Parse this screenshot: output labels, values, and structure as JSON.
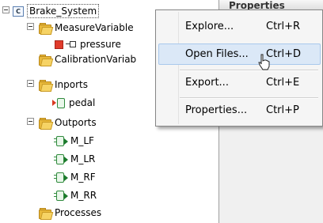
{
  "tree": {
    "root": {
      "badge": "C",
      "label": "Brake_System"
    },
    "measure": {
      "label": "MeasureVariable"
    },
    "pressure": {
      "label": "pressure"
    },
    "calibration": {
      "label": "CalibrationVariab"
    },
    "inports": {
      "label": "Inports"
    },
    "pedal": {
      "label": "pedal"
    },
    "outports": {
      "label": "Outports"
    },
    "m_lf": {
      "label": "M_LF"
    },
    "m_lr": {
      "label": "M_LR"
    },
    "m_rf": {
      "label": "M_RF"
    },
    "m_rr": {
      "label": "M_RR"
    },
    "processes": {
      "label": "Processes"
    }
  },
  "panel": {
    "header": "Properties"
  },
  "context_menu": {
    "items": [
      {
        "label": "Explore...",
        "shortcut": "Ctrl+R"
      },
      {
        "label": "Open Files...",
        "shortcut": "Ctrl+D"
      },
      {
        "label": "Export...",
        "shortcut": "Ctrl+E"
      },
      {
        "label": "Properties...",
        "shortcut": "Ctrl+P"
      }
    ],
    "highlighted_item": "Open Files..."
  },
  "colors": {
    "folder": "#e8b83a",
    "port_green": "#2f8a3c",
    "inport_arrow": "#d93a21",
    "highlight": "#dbe8f7"
  }
}
